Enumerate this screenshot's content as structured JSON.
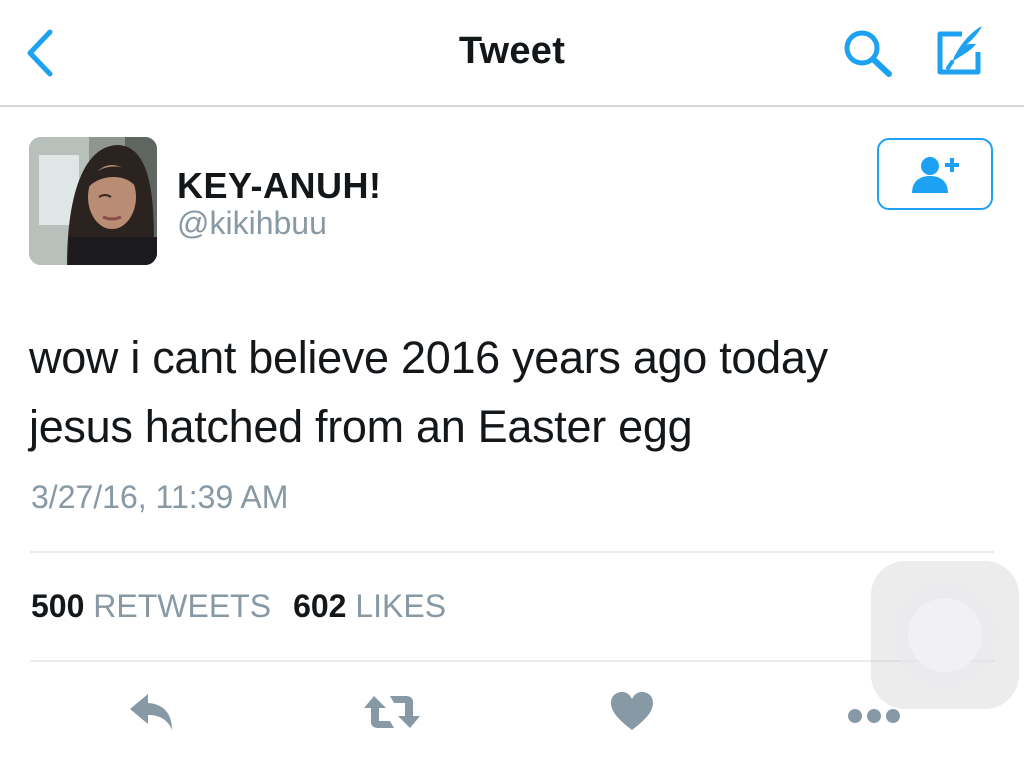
{
  "nav": {
    "title": "Tweet",
    "back_icon": "chevron-left-icon",
    "search_icon": "search-icon",
    "compose_icon": "compose-icon",
    "accent_color": "#1da1f2"
  },
  "author": {
    "display_name": "KEY-ANUH!",
    "handle": "@kikihbuu"
  },
  "tweet": {
    "text_line1": "wow i cant believe 2016 years ago today",
    "text_line2": "jesus hatched from an Easter egg",
    "timestamp": "3/27/16, 11:39 AM"
  },
  "stats": {
    "retweets_count": "500",
    "retweets_label": "RETWEETS",
    "likes_count": "602",
    "likes_label": "LIKES"
  },
  "actions": {
    "icons": [
      "reply-icon",
      "retweet-icon",
      "heart-icon",
      "more-icon"
    ],
    "icon_color": "#8899a6"
  }
}
